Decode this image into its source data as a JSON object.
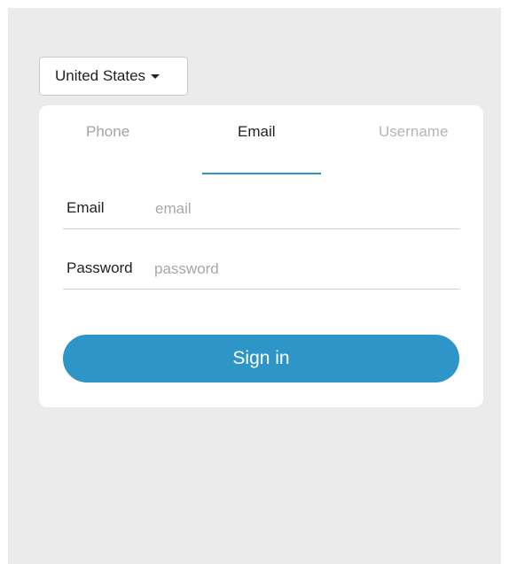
{
  "country_selector": {
    "value": "United States",
    "icon": "caret-down-icon"
  },
  "tabs": [
    {
      "label": "Phone",
      "active": false
    },
    {
      "label": "Email",
      "active": true
    },
    {
      "label": "Username",
      "active": false
    }
  ],
  "form": {
    "email": {
      "label": "Email",
      "placeholder": "email",
      "value": ""
    },
    "password": {
      "label": "Password",
      "placeholder": "password",
      "value": ""
    },
    "submit_label": "Sign in"
  },
  "colors": {
    "accent": "#2e95c9",
    "background": "#ebebeb",
    "card": "#ffffff"
  }
}
